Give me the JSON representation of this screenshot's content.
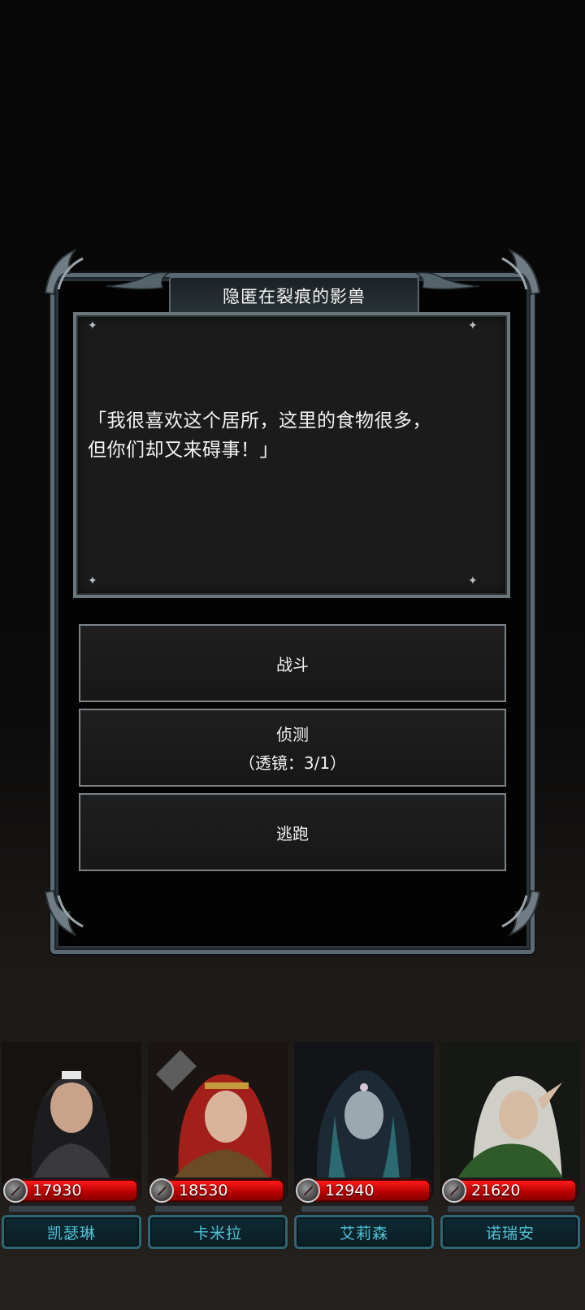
{
  "dialog": {
    "title": "隐匿在裂痕的影兽",
    "quote_line1": "「我很喜欢这个居所，这里的食物很多，",
    "quote_line2": "但你们却又来碍事！」"
  },
  "options": [
    {
      "label": "战斗",
      "sub": ""
    },
    {
      "label": "侦测",
      "sub": "（透镜：3/1）"
    },
    {
      "label": "逃跑",
      "sub": ""
    }
  ],
  "party": [
    {
      "name": "凯瑟琳",
      "hp": "17930",
      "accent": "#2b2b2b"
    },
    {
      "name": "卡米拉",
      "hp": "18530",
      "accent": "#b32a1e"
    },
    {
      "name": "艾莉森",
      "hp": "12940",
      "accent": "#2f4a52"
    },
    {
      "name": "诺瑞安",
      "hp": "21620",
      "accent": "#3b6a2e"
    }
  ],
  "colors": {
    "hp_bar": "#e00000",
    "name_text": "#4fc2d6",
    "frame": "#5b6a72"
  }
}
